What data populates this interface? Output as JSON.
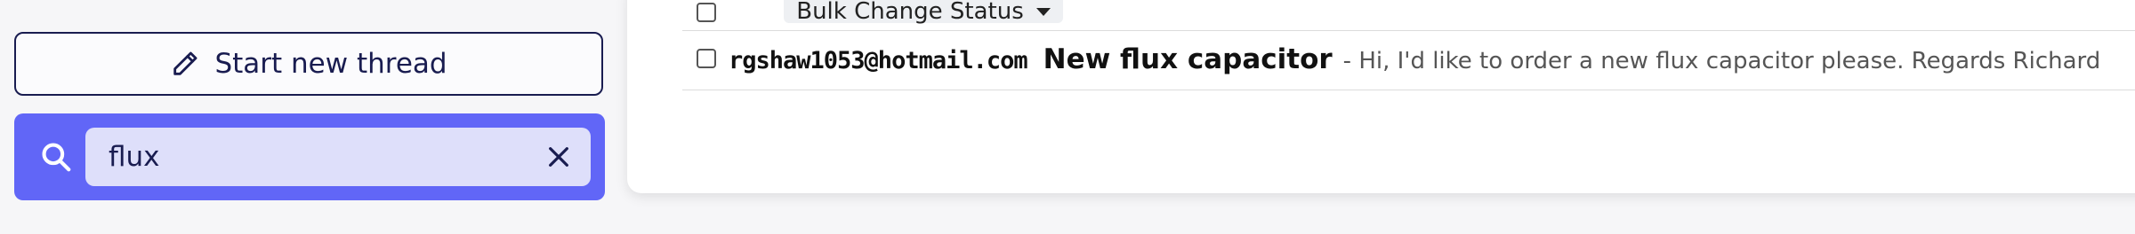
{
  "sidebar": {
    "new_thread_label": "Start new thread",
    "search": {
      "value": "flux",
      "placeholder": ""
    }
  },
  "toolbar": {
    "bulk_change_label": "Bulk Change Status"
  },
  "threads": [
    {
      "sender": "rgshaw1053@hotmail.com",
      "subject": "New flux capacitor",
      "snippet": "- Hi, I'd like to order a new flux capacitor please. Regards Richard"
    }
  ],
  "colors": {
    "accent": "#6166f7",
    "accent_light": "#dedffa",
    "navy": "#191c50"
  },
  "icons": {
    "new_thread": "pencil-icon",
    "search": "search-icon",
    "clear": "close-icon",
    "bulk_dropdown": "caret-down-icon"
  }
}
